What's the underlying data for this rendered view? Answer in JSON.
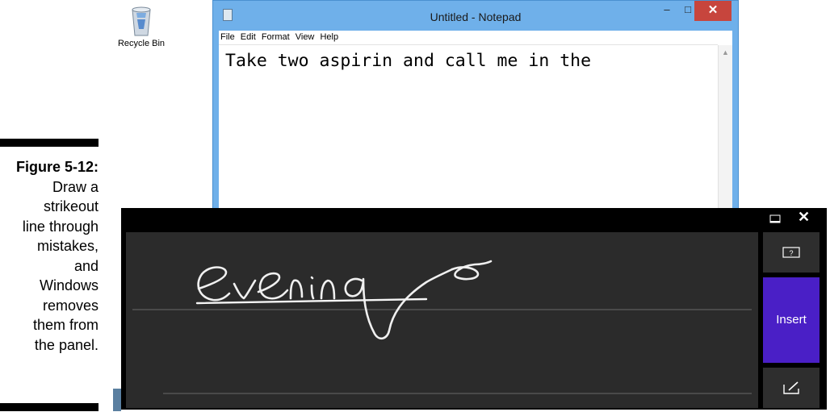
{
  "figure": {
    "label": "Figure 5-12:",
    "caption_lines": [
      "Draw a",
      "strikeout",
      "line through",
      "mistakes,",
      "and",
      "Windows",
      "removes",
      "them from",
      "the panel."
    ]
  },
  "desktop": {
    "recycle_bin_label": "Recycle Bin"
  },
  "notepad": {
    "title": "Untitled - Notepad",
    "menu": [
      "File",
      "Edit",
      "Format",
      "View",
      "Help"
    ],
    "content": "Take two aspirin and call me in the",
    "buttons": {
      "minimize": "–",
      "maximize": "□",
      "close": "✕"
    }
  },
  "input_panel": {
    "handwriting": "evening",
    "strikeout": true,
    "insert_label": "Insert",
    "close_glyph": "✕",
    "colors": {
      "accent": "#4a1fc6",
      "canvas": "#2b2b2b",
      "frame": "#000000",
      "ink": "#ffffff"
    }
  }
}
